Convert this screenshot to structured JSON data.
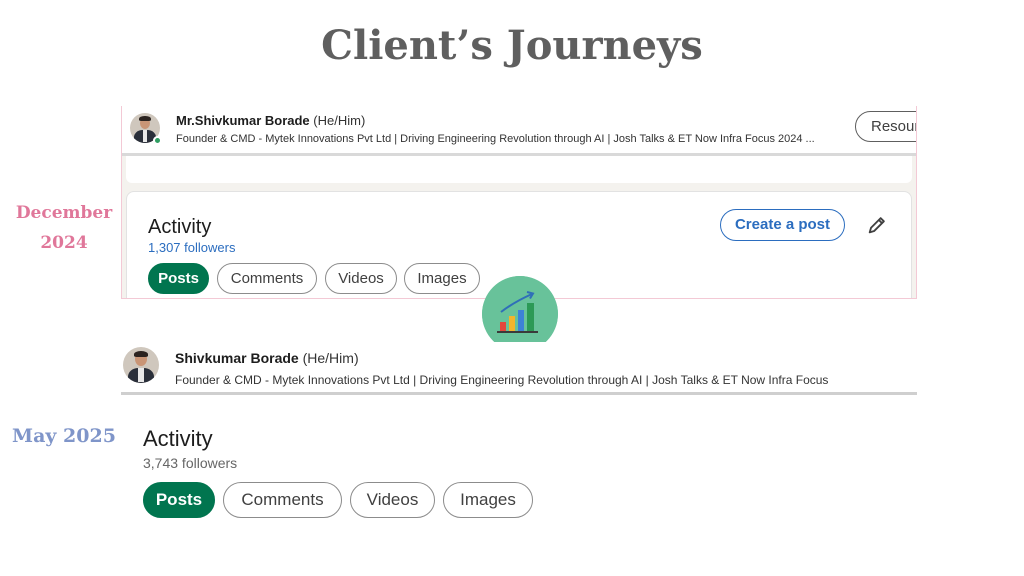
{
  "slide": {
    "title": "Client’s Journeys"
  },
  "snapshot_1": {
    "date_label_line1": "December",
    "date_label_line2": "2024",
    "name": "Mr.Shivkumar Borade",
    "pronouns": "(He/Him)",
    "headline": "Founder & CMD - Mytek Innovations Pvt Ltd | Driving Engineering Revolution through AI | Josh Talks & ET Now Infra Focus 2024 ...",
    "resources_button": "Resour",
    "activity_title": "Activity",
    "followers": "1,307 followers",
    "create_post_button": "Create a post",
    "tabs": [
      "Posts",
      "Comments",
      "Videos",
      "Images"
    ],
    "active_tab": "Posts"
  },
  "snapshot_2": {
    "date_label": "May 2025",
    "name": "Shivkumar Borade",
    "pronouns": "(He/Him)",
    "headline": "Founder & CMD - Mytek Innovations Pvt Ltd | Driving Engineering Revolution through AI | Josh Talks & ET Now Infra Focus",
    "activity_title": "Activity",
    "followers": "3,743 followers",
    "tabs": [
      "Posts",
      "Comments",
      "Videos",
      "Images"
    ],
    "active_tab": "Posts"
  },
  "icons": {
    "growth": "bar-chart-growth-icon",
    "edit": "pencil-icon",
    "avatar": "profile-avatar"
  },
  "colors": {
    "title": "#5f5f5f",
    "december_label": "#e0779a",
    "may_label": "#7f95c9",
    "linkedin_green": "#01754f",
    "linkedin_blue": "#2b6dbf",
    "growth_circle": "#68c29a"
  }
}
